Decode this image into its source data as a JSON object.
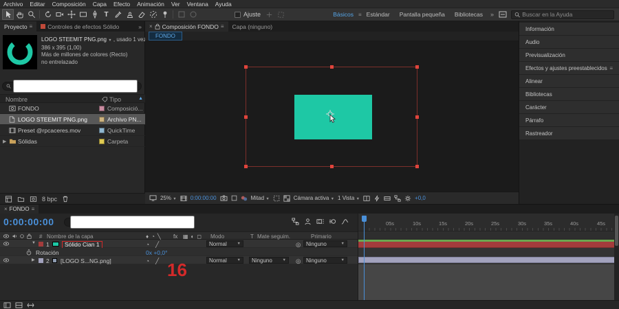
{
  "menu": {
    "items": [
      "Archivo",
      "Editar",
      "Composición",
      "Capa",
      "Efecto",
      "Animación",
      "Ver",
      "Ventana",
      "Ayuda"
    ]
  },
  "toolbar": {
    "snap_label": "Ajuste",
    "workspaces": [
      "Básicos",
      "Estándar",
      "Pantalla pequeña",
      "Bibliotecas"
    ],
    "overflow": "»",
    "search_placeholder": "Buscar en la Ayuda"
  },
  "project": {
    "tab": "Proyecto",
    "effects_tab": "Controles de efectos Sólido",
    "overflow": "»",
    "preview": {
      "title": "LOGO STEEMIT  PNG.png",
      "usage": ", usado 1 vez",
      "dims": "386 x 395 (1,00)",
      "color_depth": "Más de millones de colores (Recto)",
      "interlace": "no entrelazado"
    },
    "columns": {
      "name": "Nombre",
      "type": "Tipo"
    },
    "items": [
      {
        "name": "FONDO",
        "type": "Composició...",
        "label": "#c98ba0"
      },
      {
        "name": "LOGO STEEMIT  PNG.png",
        "type": "Archivo PN...",
        "label": "#cdb37f"
      },
      {
        "name": "Preset @rpcaceres.mov",
        "type": "QuickTime",
        "label": "#8fb6cf"
      },
      {
        "name": "Sólidas",
        "type": "Carpeta",
        "label": "#e0ca52"
      }
    ],
    "footer_bpc": "8 bpc"
  },
  "comp": {
    "tab_main": "Composición FONDO",
    "tab_layer": "Capa (ninguno)",
    "viewer_chip": "FONDO",
    "status": {
      "zoom": "25%",
      "timecode": "0:00:00:00",
      "resolution": "Mitad",
      "camera": "Cámara activa",
      "views": "1 Vista",
      "exposure": "+0,0"
    }
  },
  "sidebar": {
    "panels": [
      "Información",
      "Audio",
      "Previsualización",
      "Efectos y ajustes preestablecidos",
      "Alinear",
      "Bibliotecas",
      "Carácter",
      "Párrafo",
      "Rastreador"
    ]
  },
  "timeline": {
    "tab": "FONDO",
    "timecode": "0:00:00:00",
    "columns": {
      "num": "#",
      "name": "Nombre de la capa",
      "mode": "Modo",
      "t": "T",
      "matte": "Mate seguim.",
      "parent": "Primario"
    },
    "layers": [
      {
        "num": "1",
        "name": "Sólido Cian 1",
        "mode": "Normal",
        "parent": "Ninguno"
      },
      {
        "num": "2",
        "name": "[LOGO S...NG.png]",
        "mode": "Normal",
        "matte": "Ninguno",
        "parent": "Ninguno"
      }
    ],
    "property": {
      "name": "Rotación",
      "value": "0x +0,0°"
    },
    "ruler": [
      "05s",
      "10s",
      "15s",
      "20s",
      "25s",
      "30s",
      "35s",
      "40s",
      "45s"
    ],
    "annotation": "16"
  },
  "colors": {
    "accent_blue": "#4a90d9",
    "teal": "#1ec8a5",
    "handle_red": "#e0443c",
    "annotation_red": "#d42a2a",
    "bar_red": "#a33c3c",
    "workarea_green": "#6aa84f",
    "bar_lavender": "#a2a2bd",
    "tab_swatch_red": "#c04a3a"
  }
}
